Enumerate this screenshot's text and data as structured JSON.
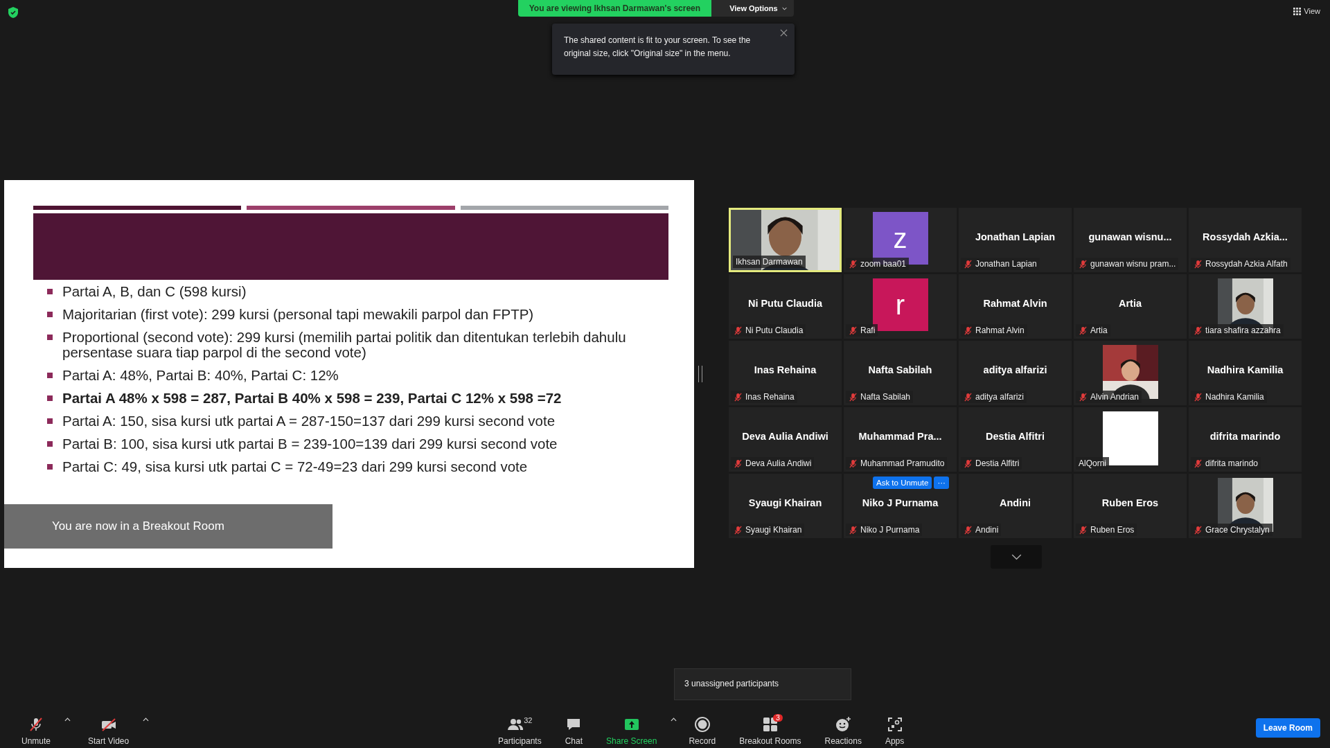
{
  "top_bar": {
    "viewing_banner": "You are viewing Ikhsan Darmawan's screen",
    "view_options": "View Options",
    "view_button": "View"
  },
  "notice": {
    "text": "The shared content is fit to your screen. To see the original size, click \"Original size\" in the menu."
  },
  "slide": {
    "bullets": [
      {
        "text": "Partai A, B, dan C (598 kursi)",
        "bold": false
      },
      {
        "text": "Majoritarian (first vote): 299 kursi (personal tapi mewakili parpol dan FPTP)",
        "bold": false
      },
      {
        "text": "Proportional (second vote): 299 kursi (memilih partai politik dan ditentukan terlebih dahulu persentase suara tiap parpol di the second vote)",
        "bold": false
      },
      {
        "text": "Partai A: 48%, Partai B: 40%, Partai C: 12%",
        "bold": false
      },
      {
        "text": "Partai A 48% x 598 = 287, Partai B 40% x 598 = 239, Partai C 12% x 598 =72",
        "bold": true
      },
      {
        "text": "Partai A: 150, sisa kursi utk partai A = 287-150=137 dari 299 kursi second vote",
        "bold": false
      },
      {
        "text": "Partai B: 100, sisa kursi utk partai B = 239-100=139 dari 299 kursi second vote",
        "bold": false
      },
      {
        "text": "Partai C: 49, sisa kursi utk partai C = 72-49=23 dari 299 kursi second vote",
        "bold": false
      }
    ]
  },
  "breakout_toast": "You are now in a Breakout Room",
  "participants": [
    {
      "kind": "video",
      "label": "Ikhsan Darmawan",
      "muted": false,
      "speaking": true
    },
    {
      "kind": "avatar",
      "letter": "z",
      "color": "#7d55c7",
      "label": "zoom baa01",
      "muted": true,
      "speaking": false
    },
    {
      "kind": "name",
      "name": "Jonathan Lapian",
      "label": "Jonathan Lapian",
      "muted": true,
      "speaking": false
    },
    {
      "kind": "name",
      "name": "gunawan wisnu...",
      "label": "gunawan wisnu pram...",
      "muted": true,
      "speaking": false
    },
    {
      "kind": "name",
      "name": "Rossydah Azkia...",
      "label": "Rossydah Azkia Alfath",
      "muted": true,
      "speaking": false
    },
    {
      "kind": "name",
      "name": "Ni Putu Claudia",
      "label": "Ni Putu Claudia",
      "muted": true,
      "speaking": false
    },
    {
      "kind": "avatar",
      "letter": "r",
      "color": "#c8175a",
      "label": "Rafi",
      "muted": true,
      "speaking": false
    },
    {
      "kind": "name",
      "name": "Rahmat Alvin",
      "label": "Rahmat Alvin",
      "muted": true,
      "speaking": false
    },
    {
      "kind": "name",
      "name": "Artia",
      "label": "Artia",
      "muted": true,
      "speaking": false
    },
    {
      "label": "tiara shafira azzahra",
      "muted": true,
      "speaking": false
    },
    {
      "kind": "name",
      "name": "Inas Rehaina",
      "label": "Inas Rehaina",
      "muted": true,
      "speaking": false
    },
    {
      "kind": "name",
      "name": "Nafta Sabilah",
      "label": "Nafta Sabilah",
      "muted": true,
      "speaking": false
    },
    {
      "kind": "name",
      "name": "aditya alfarizi",
      "label": "aditya alfarizi",
      "muted": true,
      "speaking": false
    },
    {
      "label": "Alvin Andrian",
      "muted": true,
      "speaking": false
    },
    {
      "kind": "name",
      "name": "Nadhira Kamilia",
      "label": "Nadhira Kamilia",
      "muted": true,
      "speaking": false
    },
    {
      "kind": "name",
      "name": "Deva Aulia Andiwi",
      "label": "Deva Aulia Andiwi",
      "muted": true,
      "speaking": false
    },
    {
      "kind": "name",
      "name": "Muhammad Pra...",
      "label": "Muhammad Pramudito",
      "muted": true,
      "speaking": false
    },
    {
      "kind": "name",
      "name": "Destia Alfitri",
      "label": "Destia Alfitri",
      "muted": true,
      "speaking": false
    },
    {
      "kind": "blank",
      "label": "AlQorni",
      "muted": false,
      "speaking": false
    },
    {
      "kind": "name",
      "name": "difrita marindo",
      "label": "difrita marindo",
      "muted": true,
      "speaking": false
    },
    {
      "kind": "name",
      "name": "Syaugi Khairan",
      "label": "Syaugi Khairan",
      "muted": true,
      "speaking": false
    },
    {
      "kind": "name",
      "name": "Niko J Purnama",
      "label": "Niko J Purnama",
      "muted": true,
      "speaking": false,
      "actions": [
        "Ask to Unmute",
        "···"
      ]
    },
    {
      "kind": "name",
      "name": "Andini",
      "label": "Andini",
      "muted": true,
      "speaking": false
    },
    {
      "kind": "name",
      "name": "Ruben Eros",
      "label": "Ruben Eros",
      "muted": true,
      "speaking": false
    },
    {
      "label": "Grace Chrystalyn",
      "muted": true,
      "speaking": false
    }
  ],
  "unassigned_tooltip": "3 unassigned participants",
  "toolbar": {
    "left": [
      {
        "kind": "mic",
        "label": "Unmute",
        "caret": true
      },
      {
        "kind": "camera",
        "label": "Start Video",
        "caret": true
      }
    ],
    "center": [
      {
        "kind": "participants",
        "label": "Participants",
        "count": "32",
        "caret": false
      },
      {
        "kind": "chat",
        "label": "Chat",
        "caret": false
      },
      {
        "kind": "share",
        "label": "Share Screen",
        "caret": true
      },
      {
        "kind": "record",
        "label": "Record",
        "caret": false
      },
      {
        "kind": "breakout",
        "label": "Breakout Rooms",
        "badge": "3",
        "caret": false
      },
      {
        "kind": "reactions",
        "label": "Reactions",
        "caret": false
      },
      {
        "kind": "apps",
        "label": "Apps",
        "caret": false
      }
    ],
    "leave": "Leave Room"
  }
}
